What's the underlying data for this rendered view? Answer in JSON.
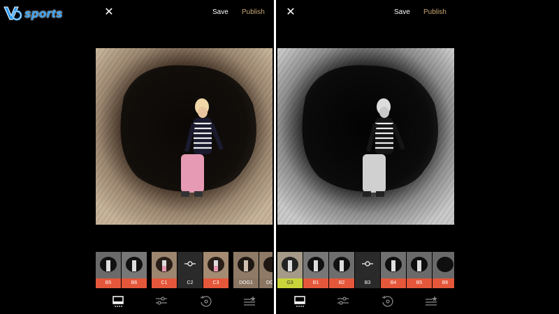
{
  "logo": {
    "text": "sports"
  },
  "screens": [
    {
      "close_label": "✕",
      "save_label": "Save",
      "publish_label": "Publish",
      "filters": [
        {
          "label": "B5",
          "style": "red"
        },
        {
          "label": "B6",
          "style": "red"
        },
        {
          "label": "C1",
          "style": "red"
        },
        {
          "label": "C2",
          "style": "selected"
        },
        {
          "label": "C3",
          "style": "red"
        },
        {
          "label": "DOG1",
          "style": "tan"
        },
        {
          "label": "DOG",
          "style": "tan"
        }
      ]
    },
    {
      "close_label": "✕",
      "save_label": "Save",
      "publish_label": "Publish",
      "filters": [
        {
          "label": "G3",
          "style": "lime"
        },
        {
          "label": "B1",
          "style": "red"
        },
        {
          "label": "B2",
          "style": "red"
        },
        {
          "label": "B3",
          "style": "selected"
        },
        {
          "label": "B4",
          "style": "red"
        },
        {
          "label": "B5",
          "style": "red"
        },
        {
          "label": "B6",
          "style": "red"
        }
      ]
    }
  ],
  "toolbar_icons": [
    "filter-presets-icon",
    "adjust-sliders-icon",
    "history-revert-icon",
    "recipes-icon"
  ],
  "colors": {
    "publish": "#c9a872",
    "filter_red": "#e5573a",
    "filter_lime": "#c8d43a",
    "logo_blue": "#2d9bf0"
  }
}
